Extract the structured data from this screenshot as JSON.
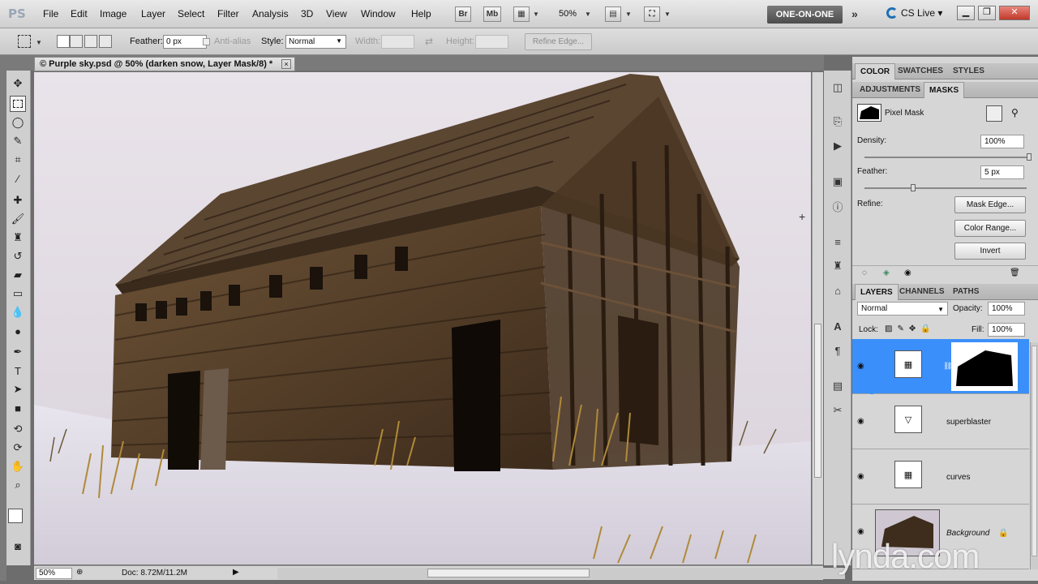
{
  "app": {
    "logo": "PS"
  },
  "menus": [
    "File",
    "Edit",
    "Image",
    "Layer",
    "Select",
    "Filter",
    "Analysis",
    "3D",
    "View",
    "Window",
    "Help"
  ],
  "appbar": {
    "br": "Br",
    "mb": "Mb",
    "zoom": "50%",
    "workspace": "ONE-ON-ONE",
    "more": "»",
    "cslive": "CS Live"
  },
  "options": {
    "feather_label": "Feather:",
    "feather_value": "0 px",
    "antialias_label": "Anti-alias",
    "style_label": "Style:",
    "style_value": "Normal",
    "width_label": "Width:",
    "height_label": "Height:",
    "refine_edge": "Refine Edge..."
  },
  "document": {
    "tab_title": "© Purple sky.psd @ 50% (darken snow, Layer Mask/8) *",
    "close": "×"
  },
  "status": {
    "zoom": "50%",
    "doc": "Doc: 8.72M/11.2M"
  },
  "watermark": "lynda.com",
  "panels": {
    "top_tabs": [
      "COLOR",
      "SWATCHES",
      "STYLES"
    ],
    "mid_tabs": [
      "ADJUSTMENTS",
      "MASKS"
    ],
    "masks": {
      "type": "Pixel Mask",
      "density_label": "Density:",
      "density_value": "100%",
      "feather_label": "Feather:",
      "feather_value": "5 px",
      "refine_label": "Refine:",
      "mask_edge": "Mask Edge...",
      "color_range": "Color Range...",
      "invert": "Invert"
    },
    "layer_tabs": [
      "LAYERS",
      "CHANNELS",
      "PATHS"
    ],
    "layers": {
      "blend": "Normal",
      "opacity_label": "Opacity:",
      "opacity_value": "100%",
      "lock_label": "Lock:",
      "fill_label": "Fill:",
      "fill_value": "100%",
      "rows": [
        {
          "name": ""
        },
        {
          "name": "superblaster"
        },
        {
          "name": "curves"
        },
        {
          "name": "Background"
        }
      ]
    }
  }
}
